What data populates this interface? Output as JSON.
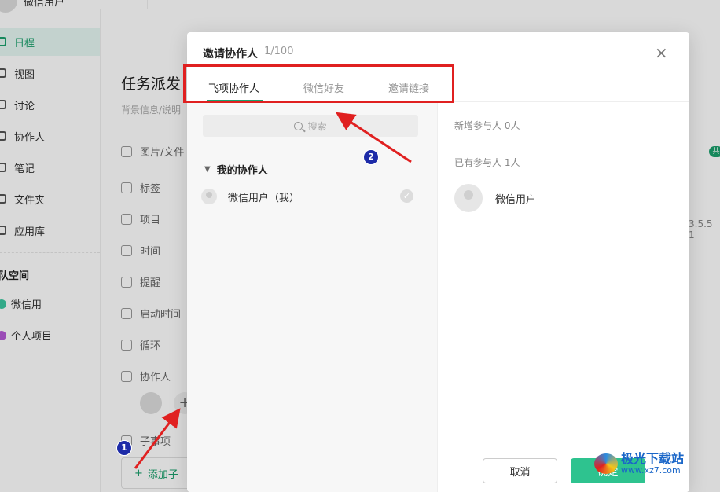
{
  "sidebar": {
    "user_name": "微信用户",
    "items": [
      {
        "label": "日程",
        "icon": "calendar-icon",
        "active": true
      },
      {
        "label": "视图",
        "icon": "view-icon"
      },
      {
        "label": "讨论",
        "icon": "chat-icon"
      },
      {
        "label": "协作人",
        "icon": "people-icon"
      },
      {
        "label": "笔记",
        "icon": "note-icon"
      },
      {
        "label": "文件夹",
        "icon": "folder-icon"
      },
      {
        "label": "应用库",
        "icon": "apps-icon"
      }
    ],
    "section_title": "队空间",
    "projects": [
      {
        "label": "微信用",
        "color": "#3cc7a0"
      },
      {
        "label": "个人项目",
        "color": "#b65ad6"
      }
    ]
  },
  "task": {
    "title": "任务派发",
    "desc": "背景信息/说明",
    "fields": [
      "图片/文件",
      "标签",
      "项目",
      "时间",
      "提醒",
      "启动时间",
      "循环",
      "协作人"
    ],
    "subtask_label": "子事项",
    "add_subtask_label": "添加子",
    "version_text": "3.5.5 1",
    "badge": "共"
  },
  "dialog": {
    "title": "邀请协作人",
    "count": "1/100",
    "close_glyph": "×",
    "tabs": [
      "飞项协作人",
      "微信好友",
      "邀请链接"
    ],
    "search_placeholder": "搜索",
    "group_title": "我的协作人",
    "left_users": [
      {
        "name": "微信用户（我）"
      }
    ],
    "new_participants": "新增参与人 0人",
    "existing_participants": "已有参与人 1人",
    "right_users": [
      {
        "name": "微信用户"
      }
    ],
    "cancel_label": "取消",
    "ok_label": "确定"
  },
  "annotations": {
    "num1": "1",
    "num2": "2"
  },
  "watermark": {
    "cn": "极光下载站",
    "url": "www.xz7.com"
  },
  "colors": {
    "accent": "#1aa06d",
    "ok_button": "#2ec38f",
    "annotation_red": "#e02020",
    "annotation_blue": "#1d2ba8"
  }
}
